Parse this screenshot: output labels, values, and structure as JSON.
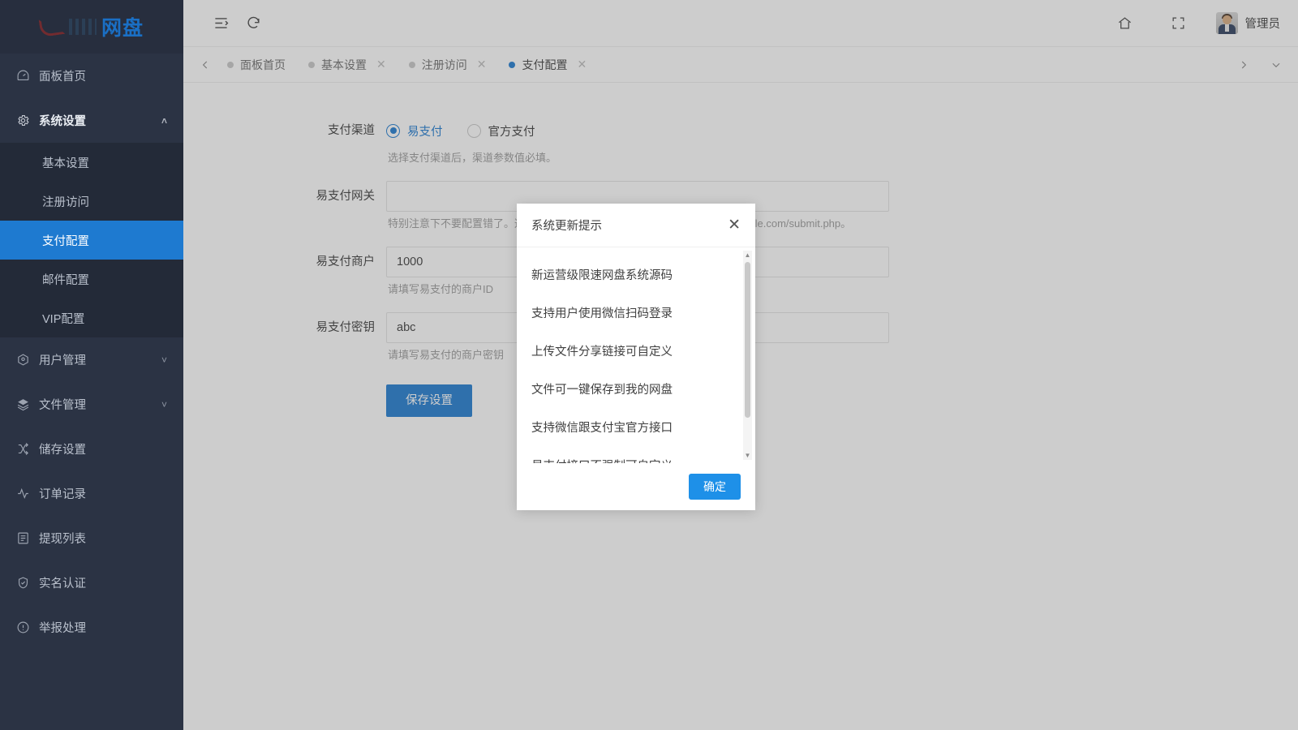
{
  "brand": {
    "logo_text": "网盘",
    "accent": "#1e7ad0",
    "sidebar_bg": "#2b3344"
  },
  "sidebar": {
    "items": [
      {
        "label": "面板首页",
        "icon": "dashboard-icon",
        "type": "link",
        "caret": ""
      },
      {
        "label": "系统设置",
        "icon": "gear-icon",
        "type": "group",
        "caret": "˄"
      },
      {
        "label": "用户管理",
        "icon": "users-icon",
        "type": "group",
        "caret": "˅"
      },
      {
        "label": "文件管理",
        "icon": "layers-icon",
        "type": "group",
        "caret": "˅"
      },
      {
        "label": "储存设置",
        "icon": "shuffle-icon",
        "type": "link",
        "caret": ""
      },
      {
        "label": "订单记录",
        "icon": "activity-icon",
        "type": "link",
        "caret": ""
      },
      {
        "label": "提现列表",
        "icon": "list-icon",
        "type": "link",
        "caret": ""
      },
      {
        "label": "实名认证",
        "icon": "shield-check-icon",
        "type": "link",
        "caret": ""
      },
      {
        "label": "举报处理",
        "icon": "info-icon",
        "type": "link",
        "caret": ""
      }
    ],
    "system_subitems": [
      {
        "label": "基本设置",
        "active": false
      },
      {
        "label": "注册访问",
        "active": false
      },
      {
        "label": "支付配置",
        "active": true
      },
      {
        "label": "邮件配置",
        "active": false
      },
      {
        "label": "VIP配置",
        "active": false
      }
    ]
  },
  "topbar": {
    "menu_toggle_icon": "indent-menu-icon",
    "refresh_icon": "refresh-icon",
    "home_icon": "home-icon",
    "fullscreen_icon": "fullscreen-icon",
    "user_name": "管理员",
    "avatar_icon": "avatar"
  },
  "tabbar": {
    "prev_icon": "chevron-left-icon",
    "next_icon": "chevron-right-icon",
    "dropdown_icon": "chevron-down-icon",
    "close_glyph": "✕",
    "tabs": [
      {
        "label": "面板首页",
        "closable": false,
        "active": false
      },
      {
        "label": "基本设置",
        "closable": true,
        "active": false
      },
      {
        "label": "注册访问",
        "closable": true,
        "active": false
      },
      {
        "label": "支付配置",
        "closable": true,
        "active": true
      }
    ]
  },
  "form": {
    "channel": {
      "label": "支付渠道",
      "options": [
        {
          "label": "易支付",
          "checked": true
        },
        {
          "label": "官方支付",
          "checked": false
        }
      ],
      "hint": "选择支付渠道后，渠道参数值必填。"
    },
    "gateway": {
      "label": "易支付网关",
      "value": "",
      "placeholder": "",
      "hint": "特别注意下不要配置错了。这里必须是支付接口地址，例如：https://pay.example.com/submit.php。"
    },
    "merchant": {
      "label": "易支付商户",
      "value": "1000",
      "hint": "请填写易支付的商户ID"
    },
    "secret": {
      "label": "易支付密钥",
      "value": "abc",
      "hint": "请填写易支付的商户密钥"
    },
    "save_label": "保存设置"
  },
  "modal": {
    "title": "系统更新提示",
    "close_glyph": "✕",
    "items": [
      "新运营级限速网盘系统源码",
      "支持用户使用微信扫码登录",
      "上传文件分享链接可自定义",
      "文件可一键保存到我的网盘",
      "支持微信跟支付宝官方接口",
      "易支付接口不强制可自定义"
    ],
    "scroll_up_glyph": "▲",
    "scroll_down_glyph": "▼",
    "ok_label": "确定"
  }
}
